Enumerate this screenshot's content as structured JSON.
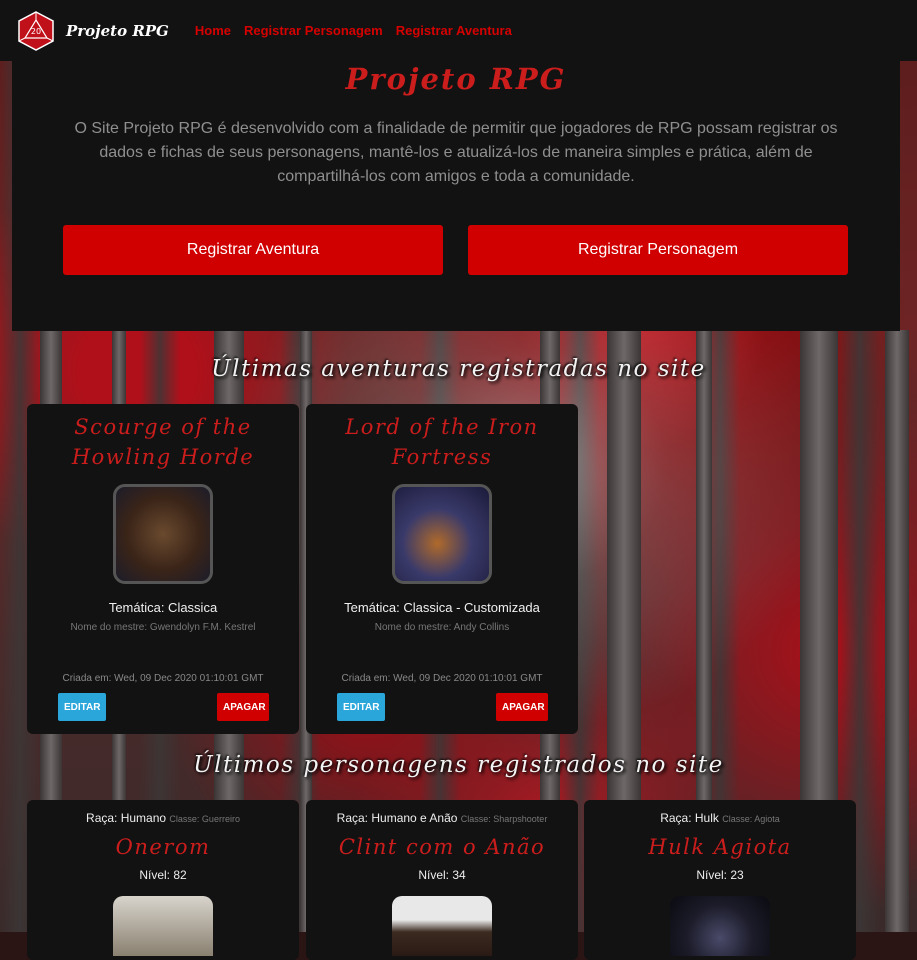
{
  "navbar": {
    "brand": "Projeto RPG",
    "logo_number": "20",
    "links": [
      "Home",
      "Registrar Personagem",
      "Registrar Aventura"
    ]
  },
  "hero": {
    "title": "Projeto RPG",
    "description": "O Site Projeto RPG é desenvolvido com a finalidade de permitir que jogadores de RPG possam registrar os dados e fichas de seus personagens, mantê-los e atualizá-los de maneira simples e prática, além de compartilhá-los com amigos e toda a comunidade.",
    "btn_aventura": "Registrar Aventura",
    "btn_personagem": "Registrar Personagem"
  },
  "adventures": {
    "heading": "Últimas aventuras registradas no site",
    "items": [
      {
        "title": "Scourge of the Howling Horde",
        "theme": "Temática: Classica",
        "master": "Nome do mestre: Gwendolyn F.M. Kestrel",
        "created": "Criada em: Wed, 09 Dec 2020 01:10:01 GMT",
        "edit": "EDITAR",
        "delete": "APAGAR"
      },
      {
        "title": "Lord of the Iron Fortress",
        "theme": "Temática: Classica - Customizada",
        "master": "Nome do mestre: Andy Collins",
        "created": "Criada em: Wed, 09 Dec 2020 01:10:01 GMT",
        "edit": "EDITAR",
        "delete": "APAGAR"
      }
    ]
  },
  "characters": {
    "heading": "Últimos personagens registrados no site",
    "items": [
      {
        "race": "Raça: Humano",
        "class": "Classe: Guerreiro",
        "name": "Onerom",
        "level": "Nível: 82"
      },
      {
        "race": "Raça: Humano e Anão",
        "class": "Classe: Sharpshooter",
        "name": "Clint com o Anão",
        "level": "Nível: 34"
      },
      {
        "race": "Raça: Hulk",
        "class": "Classe: Agiota",
        "name": "Hulk Agiota",
        "level": "Nível: 23"
      }
    ]
  },
  "colors": {
    "accent_red": "#d00000",
    "title_red": "#cc1d1d",
    "panel": "#121212",
    "edit_blue": "#2aa6db"
  }
}
